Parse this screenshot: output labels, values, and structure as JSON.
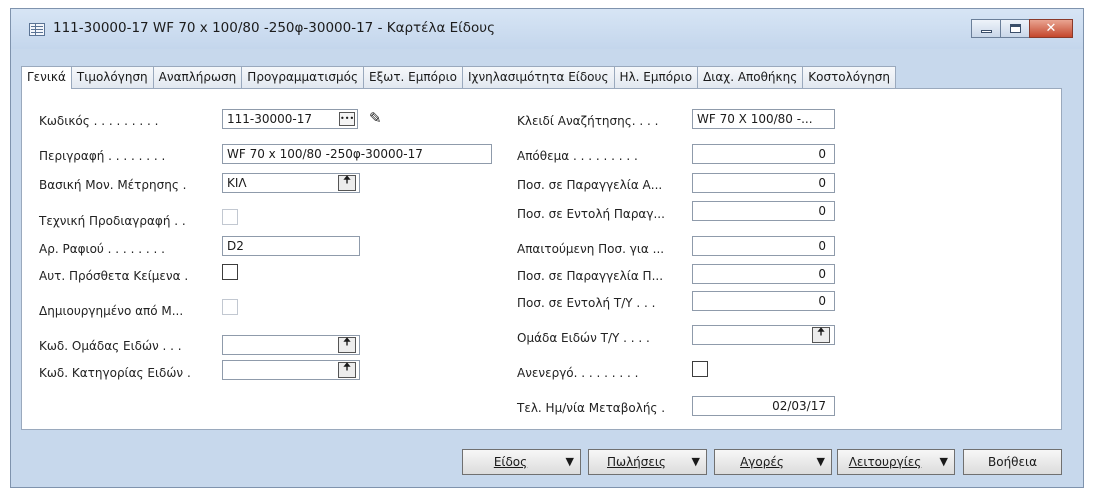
{
  "window": {
    "title": "111-30000-17 WF 70 x 100/80 -250φ-30000-17 - Καρτέλα Είδους"
  },
  "tabs": [
    {
      "label": "Γενικά"
    },
    {
      "label": "Τιμολόγηση"
    },
    {
      "label": "Αναπλήρωση"
    },
    {
      "label": "Προγραμματισμός"
    },
    {
      "label": "Εξωτ. Εμπόριο"
    },
    {
      "label": "Ιχνηλασιμότητα Είδους"
    },
    {
      "label": "Ηλ. Εμπόριο"
    },
    {
      "label": "Διαχ. Αποθήκης"
    },
    {
      "label": "Κοστολόγηση"
    }
  ],
  "left": {
    "code_label": "Κωδικός . . . . . . . . .",
    "code_value": "111-30000-17",
    "description_label": "Περιγραφή . . . . . . . .",
    "description_value": "WF 70 x 100/80 -250φ-30000-17",
    "base_uom_label": "Βασική Μον. Μέτρησης .",
    "base_uom_value": "ΚΙΛ",
    "tech_spec_label": "Τεχνική Προδιαγραφή . .",
    "shelf_label": "Αρ. Ραφιού . . . . . . . .",
    "shelf_value": "D2",
    "ext_text_label": "Αυτ. Πρόσθετα Κείμενα .",
    "created_from_label": "Δημιουργημένο από Μ...",
    "group_code_label": "Κωδ. Ομάδας Ειδών . . .",
    "group_code_value": "",
    "category_code_label": "Κωδ. Κατηγορίας Ειδών .",
    "category_code_value": ""
  },
  "right": {
    "search_key_label": "Κλειδί Αναζήτησης. . . .",
    "search_key_value": "WF 70 X 100/80 -...",
    "inventory_label": "Απόθεμα . . . . . . . . .",
    "inventory_value": "0",
    "qty_po_label": "Ποσ. σε Παραγγελία Α...",
    "qty_po_value": "0",
    "qty_prod_label": "Ποσ. σε Εντολή Παραγ...",
    "qty_prod_value": "0",
    "req_qty_label": "Απαιτούμενη Ποσ. για ...",
    "req_qty_value": "0",
    "qty_so_label": "Ποσ. σε Παραγγελία Π...",
    "qty_so_value": "0",
    "qty_service_label": "Ποσ. σε Εντολή Τ/Υ . . .",
    "qty_service_value": "0",
    "service_group_label": "Ομάδα Ειδών Τ/Υ . . . .",
    "service_group_value": "",
    "blocked_label": "Ανενεργό. . . . . . . . .",
    "last_modified_label": "Τελ. Ημ/νία Μεταβολής .",
    "last_modified_value": "02/03/17"
  },
  "buttons": {
    "item": "Είδος",
    "sales": "Πωλήσεις",
    "purchases": "Αγορές",
    "functions": "Λειτουργίες",
    "help": "Βοήθεια"
  },
  "icons": {
    "lookup": "ellipsis-lookup-icon",
    "edit": "pencil-icon",
    "assist": "up-arrow-assist-icon",
    "dropdown": "down-triangle-icon"
  }
}
